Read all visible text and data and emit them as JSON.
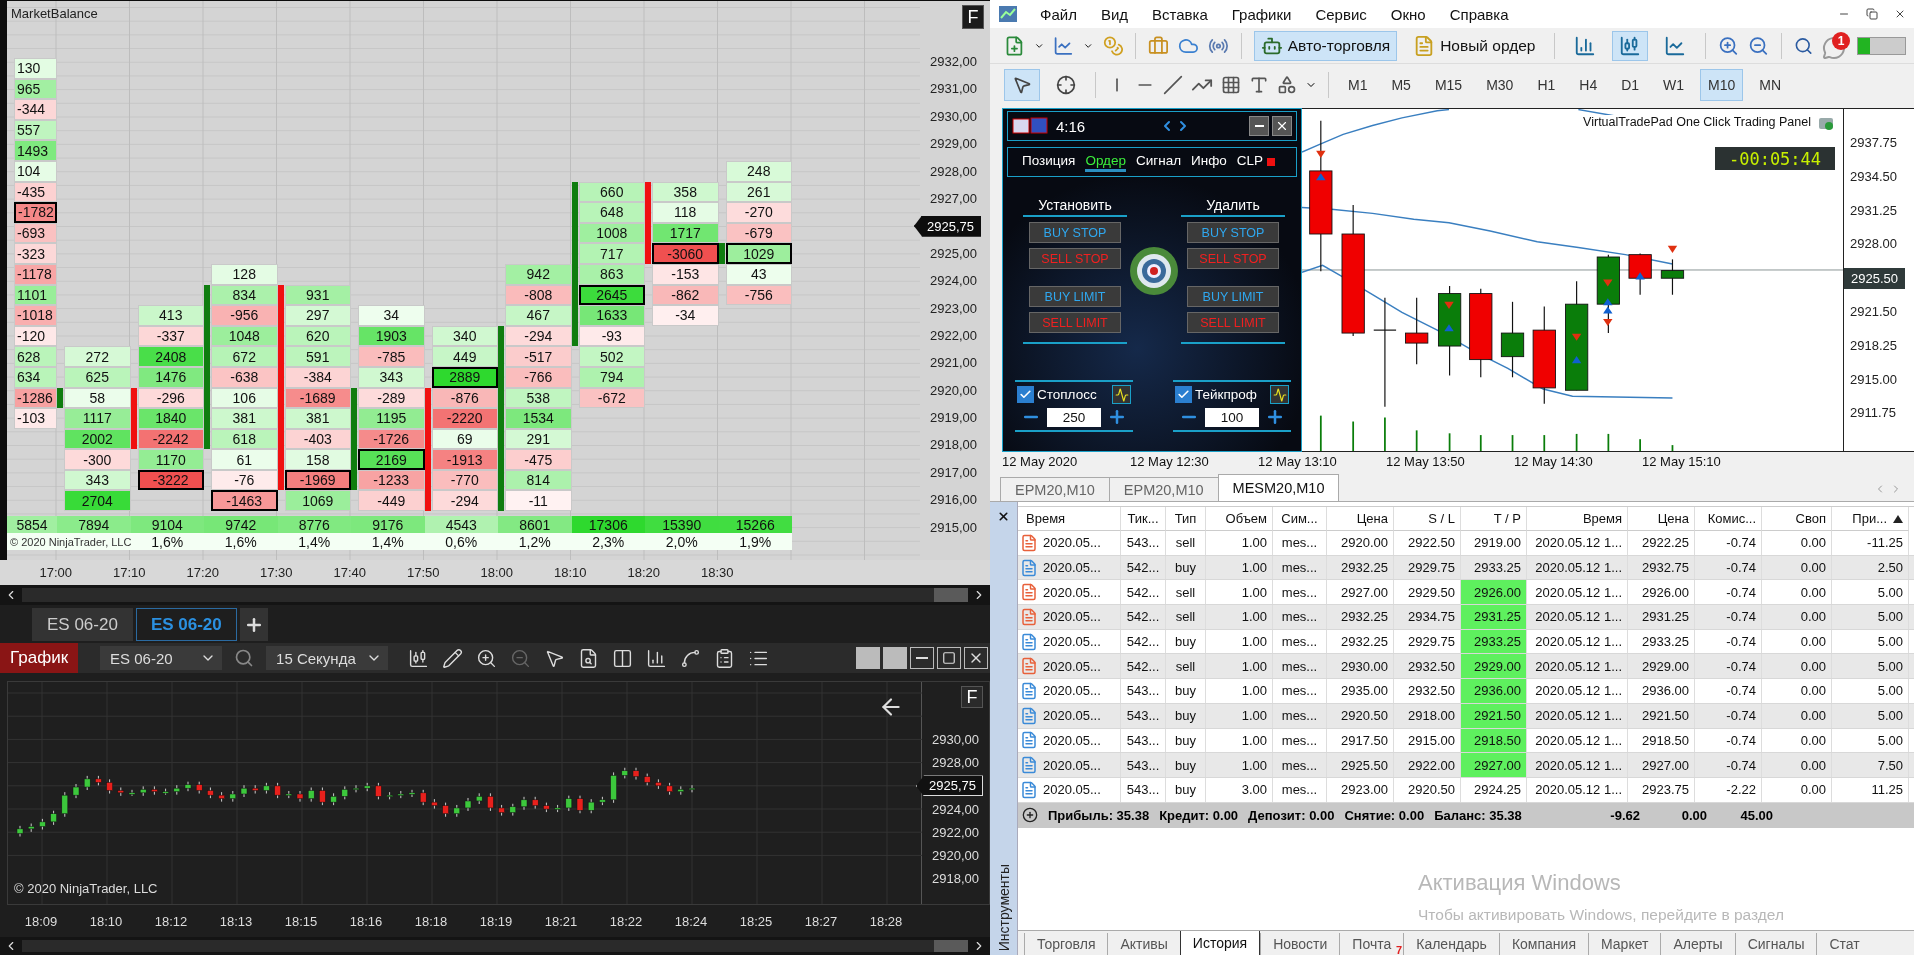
{
  "market_balance": {
    "title": "MarketBalance",
    "format_button": "F",
    "columns": [
      {
        "cells": [
          {
            "text": "130",
            "boxed": false,
            "bar": false
          },
          {
            "text": "965",
            "boxed": false,
            "bar": false
          },
          {
            "text": "-344",
            "boxed": false,
            "bar": false
          },
          {
            "text": "557",
            "boxed": false,
            "bar": false
          },
          {
            "text": "1493",
            "boxed": false,
            "bar": false
          },
          {
            "text": "104",
            "boxed": false,
            "bar": false
          },
          {
            "text": "-435",
            "boxed": false,
            "bar": false
          },
          {
            "text": "-1782",
            "boxed": true,
            "bar": false
          },
          {
            "text": "-693",
            "boxed": false,
            "bar": false
          },
          {
            "text": "-323",
            "boxed": false,
            "bar": false
          },
          {
            "text": "-1178",
            "boxed": false,
            "bar": false
          },
          {
            "text": "1101",
            "boxed": false,
            "bar": false
          },
          {
            "text": "-1018",
            "boxed": false,
            "bar": false
          },
          {
            "text": "-120",
            "boxed": false,
            "bar": false
          },
          {
            "text": "628",
            "boxed": false,
            "bar": false
          },
          {
            "text": "634",
            "boxed": false,
            "bar": false
          },
          {
            "text": "-1286",
            "boxed": false,
            "bar": false
          },
          {
            "text": "-103",
            "boxed": false,
            "bar": false
          }
        ]
      },
      {
        "rising": true,
        "cells": [
          null,
          null,
          null,
          null,
          null,
          null,
          null,
          null,
          null,
          null,
          null,
          null,
          null,
          null,
          {
            "text": "272",
            "boxed": false,
            "bar": false
          },
          {
            "text": "625",
            "boxed": false,
            "bar": false
          },
          {
            "text": "58",
            "boxed": false,
            "bar": true
          },
          {
            "text": "1117",
            "boxed": false,
            "bar": false
          },
          {
            "text": "2002",
            "boxed": false,
            "bar": false
          },
          {
            "text": "-300",
            "boxed": false,
            "bar": false
          },
          {
            "text": "343",
            "boxed": false,
            "bar": false
          },
          {
            "text": "2704",
            "boxed": false,
            "bar": false
          }
        ]
      },
      {
        "rising": false,
        "cells": [
          null,
          null,
          null,
          null,
          null,
          null,
          null,
          null,
          null,
          null,
          null,
          null,
          {
            "text": "413",
            "boxed": false,
            "bar": false
          },
          {
            "text": "-337",
            "boxed": false,
            "bar": false
          },
          {
            "text": "2408",
            "boxed": false,
            "bar": false
          },
          {
            "text": "1476",
            "boxed": false,
            "bar": false
          },
          {
            "text": "-296",
            "boxed": false,
            "bar": true
          },
          {
            "text": "1840",
            "boxed": false,
            "bar": true
          },
          {
            "text": "-2242",
            "boxed": false,
            "bar": true
          },
          {
            "text": "1170",
            "boxed": false,
            "bar": false
          },
          {
            "text": "-3222",
            "boxed": true,
            "bar": false
          }
        ]
      },
      {
        "rising": true,
        "cells": [
          null,
          null,
          null,
          null,
          null,
          null,
          null,
          null,
          null,
          null,
          {
            "text": "128",
            "boxed": false,
            "bar": false
          },
          {
            "text": "834",
            "boxed": false,
            "bar": true
          },
          {
            "text": "-956",
            "boxed": false,
            "bar": true
          },
          {
            "text": "1048",
            "boxed": false,
            "bar": true
          },
          {
            "text": "672",
            "boxed": false,
            "bar": true
          },
          {
            "text": "-638",
            "boxed": false,
            "bar": true
          },
          {
            "text": "106",
            "boxed": false,
            "bar": true
          },
          {
            "text": "381",
            "boxed": false,
            "bar": true
          },
          {
            "text": "618",
            "boxed": false,
            "bar": true
          },
          {
            "text": "61",
            "boxed": false,
            "bar": false
          },
          {
            "text": "-76",
            "boxed": false,
            "bar": false
          },
          {
            "text": "-1463",
            "boxed": true,
            "bar": false
          }
        ]
      },
      {
        "rising": false,
        "cells": [
          null,
          null,
          null,
          null,
          null,
          null,
          null,
          null,
          null,
          null,
          null,
          {
            "text": "931",
            "boxed": false,
            "bar": true
          },
          {
            "text": "297",
            "boxed": false,
            "bar": true
          },
          {
            "text": "620",
            "boxed": false,
            "bar": true
          },
          {
            "text": "591",
            "boxed": false,
            "bar": true
          },
          {
            "text": "-384",
            "boxed": false,
            "bar": true
          },
          {
            "text": "-1689",
            "boxed": false,
            "bar": true
          },
          {
            "text": "381",
            "boxed": false,
            "bar": true
          },
          {
            "text": "-403",
            "boxed": false,
            "bar": true
          },
          {
            "text": "158",
            "boxed": false,
            "bar": true
          },
          {
            "text": "-1969",
            "boxed": true,
            "bar": true
          },
          {
            "text": "1069",
            "boxed": false,
            "bar": false
          }
        ]
      },
      {
        "rising": true,
        "cells": [
          null,
          null,
          null,
          null,
          null,
          null,
          null,
          null,
          null,
          null,
          null,
          null,
          {
            "text": "34",
            "boxed": false,
            "bar": false
          },
          {
            "text": "1903",
            "boxed": false,
            "bar": false
          },
          {
            "text": "-785",
            "boxed": false,
            "bar": false
          },
          {
            "text": "343",
            "boxed": false,
            "bar": false
          },
          {
            "text": "-289",
            "boxed": false,
            "bar": true
          },
          {
            "text": "1195",
            "boxed": false,
            "bar": true
          },
          {
            "text": "-1726",
            "boxed": false,
            "bar": true
          },
          {
            "text": "2169",
            "boxed": true,
            "bar": true
          },
          {
            "text": "-1233",
            "boxed": false,
            "bar": true
          },
          {
            "text": "-449",
            "boxed": false,
            "bar": false
          }
        ]
      },
      {
        "rising": false,
        "cells": [
          null,
          null,
          null,
          null,
          null,
          null,
          null,
          null,
          null,
          null,
          null,
          null,
          null,
          {
            "text": "340",
            "boxed": false,
            "bar": false
          },
          {
            "text": "449",
            "boxed": false,
            "bar": false
          },
          {
            "text": "2889",
            "boxed": true,
            "bar": false
          },
          {
            "text": "-876",
            "boxed": false,
            "bar": true
          },
          {
            "text": "-2220",
            "boxed": false,
            "bar": true
          },
          {
            "text": "69",
            "boxed": false,
            "bar": true
          },
          {
            "text": "-1913",
            "boxed": false,
            "bar": true
          },
          {
            "text": "-770",
            "boxed": false,
            "bar": true
          },
          {
            "text": "-294",
            "boxed": false,
            "bar": true
          }
        ]
      },
      {
        "rising": true,
        "cells": [
          null,
          null,
          null,
          null,
          null,
          null,
          null,
          null,
          null,
          null,
          {
            "text": "942",
            "boxed": false,
            "bar": false
          },
          {
            "text": "-808",
            "boxed": false,
            "bar": false
          },
          {
            "text": "467",
            "boxed": false,
            "bar": false
          },
          {
            "text": "-294",
            "boxed": false,
            "bar": true
          },
          {
            "text": "-517",
            "boxed": false,
            "bar": true
          },
          {
            "text": "-766",
            "boxed": false,
            "bar": true
          },
          {
            "text": "538",
            "boxed": false,
            "bar": true
          },
          {
            "text": "1534",
            "boxed": false,
            "bar": true
          },
          {
            "text": "291",
            "boxed": false,
            "bar": true
          },
          {
            "text": "-475",
            "boxed": false,
            "bar": true
          },
          {
            "text": "814",
            "boxed": false,
            "bar": true
          },
          {
            "text": "-11",
            "boxed": false,
            "bar": true
          }
        ]
      },
      {
        "rising": true,
        "cells": [
          null,
          null,
          null,
          null,
          null,
          null,
          {
            "text": "660",
            "boxed": false,
            "bar": true
          },
          {
            "text": "648",
            "boxed": false,
            "bar": true
          },
          {
            "text": "1008",
            "boxed": false,
            "bar": true
          },
          {
            "text": "717",
            "boxed": false,
            "bar": true
          },
          {
            "text": "863",
            "boxed": false,
            "bar": true
          },
          {
            "text": "2645",
            "boxed": true,
            "bar": true
          },
          {
            "text": "1633",
            "boxed": false,
            "bar": true
          },
          {
            "text": "-93",
            "boxed": false,
            "bar": true
          },
          {
            "text": "502",
            "boxed": false,
            "bar": false
          },
          {
            "text": "794",
            "boxed": false,
            "bar": false
          },
          {
            "text": "-672",
            "boxed": false,
            "bar": false
          }
        ]
      },
      {
        "rising": false,
        "cells": [
          null,
          null,
          null,
          null,
          null,
          null,
          {
            "text": "358",
            "boxed": false,
            "bar": true
          },
          {
            "text": "118",
            "boxed": false,
            "bar": true
          },
          {
            "text": "1717",
            "boxed": false,
            "bar": true
          },
          {
            "text": "-3060",
            "boxed": true,
            "bar": true
          },
          {
            "text": "-153",
            "boxed": false,
            "bar": false
          },
          {
            "text": "-862",
            "boxed": false,
            "bar": false
          },
          {
            "text": "-34",
            "boxed": false,
            "bar": false
          }
        ]
      },
      {
        "rising": true,
        "cells": [
          null,
          null,
          null,
          null,
          null,
          {
            "text": "248",
            "boxed": false,
            "bar": false
          },
          {
            "text": "261",
            "boxed": false,
            "bar": false
          },
          {
            "text": "-270",
            "boxed": false,
            "bar": false
          },
          {
            "text": "-679",
            "boxed": false,
            "bar": false
          },
          {
            "text": "1029",
            "boxed": true,
            "bar": true
          },
          {
            "text": "43",
            "boxed": false,
            "bar": false
          },
          {
            "text": "-756",
            "boxed": false,
            "bar": false
          }
        ]
      }
    ],
    "totals": [
      "5854",
      "7894",
      "9104",
      "9742",
      "8776",
      "9176",
      "4543",
      "8601",
      "17306",
      "15390",
      "15266"
    ],
    "percents": [
      "1,6%",
      "1,6%",
      "1,4%",
      "1,4%",
      "0,6%",
      "1,2%",
      "2,3%",
      "2,0%",
      "1,9%"
    ],
    "price_axis_upper": [
      "2932,00",
      "2931,00",
      "2930,00",
      "2929,00",
      "2928,00",
      "2927,00"
    ],
    "price_axis_lower": [
      "2925,00",
      "2924,00",
      "2923,00",
      "2922,00",
      "2921,00",
      "2920,00",
      "2919,00",
      "2918,00",
      "2917,00",
      "2916,00",
      "2915,00"
    ],
    "price_tag": "2925,75",
    "copyright": "© 2020 NinjaTrader, LLC",
    "time_axis": [
      "17:00",
      "17:10",
      "17:20",
      "17:30",
      "17:40",
      "17:50",
      "18:00",
      "18:10",
      "18:20",
      "18:30"
    ]
  },
  "instrument_tabs": [
    {
      "label": "ES 06-20",
      "selected": false
    },
    {
      "label": "ES 06-20",
      "selected": true
    }
  ],
  "chart_toolbar": {
    "title": "График",
    "instrument": "ES 06-20",
    "interval": "15 Секунда"
  },
  "mini_chart": {
    "format_button": "F",
    "price_axis_upper": [
      "2930,00",
      "2928,00"
    ],
    "price_axis_lower": [
      "2924,00",
      "2922,00",
      "2920,00",
      "2918,00"
    ],
    "price_tag": "2925,75",
    "copyright": "© 2020 NinjaTrader, LLC",
    "time_axis": [
      "18:09",
      "18:10",
      "18:12",
      "18:13",
      "18:15",
      "18:16",
      "18:18",
      "18:19",
      "18:21",
      "18:22",
      "18:24",
      "18:25",
      "18:27",
      "18:28"
    ]
  },
  "menu": [
    "Файл",
    "Вид",
    "Вставка",
    "Графики",
    "Сервис",
    "Окно",
    "Справка"
  ],
  "toolbar": {
    "auto_trading": {
      "label": "Авто-торговля",
      "selected": true
    },
    "new_order": "Новый ордер",
    "chart_types": [
      {
        "kind": "bars",
        "selected": false
      },
      {
        "kind": "candles",
        "selected": true
      },
      {
        "kind": "line",
        "selected": false
      }
    ],
    "notifications": "1"
  },
  "tools": [
    {
      "kind": "cursor",
      "selected": true
    },
    {
      "kind": "crosshair",
      "selected": false
    }
  ],
  "timeframes": [
    {
      "label": "M1",
      "selected": false
    },
    {
      "label": "M5",
      "selected": false
    },
    {
      "label": "M15",
      "selected": false
    },
    {
      "label": "M30",
      "selected": false
    },
    {
      "label": "H1",
      "selected": false
    },
    {
      "label": "H4",
      "selected": false
    },
    {
      "label": "D1",
      "selected": false
    },
    {
      "label": "W1",
      "selected": false
    },
    {
      "label": "M10",
      "selected": true
    },
    {
      "label": "MN",
      "selected": false
    }
  ],
  "trade_panel": {
    "clock": "4:16",
    "tabs": [
      {
        "label": "Позиция",
        "selected": false
      },
      {
        "label": "Ордер",
        "selected": true
      },
      {
        "label": "Сигнал",
        "selected": false
      },
      {
        "label": "Инфо",
        "selected": false
      },
      {
        "label": "CLP",
        "selected": false
      }
    ],
    "groups": [
      {
        "heading": "Установить",
        "buttons": [
          {
            "label": "BUY STOP",
            "kind": "buy"
          },
          {
            "label": "SELL STOP",
            "kind": "sell"
          },
          {
            "label": "BUY LIMIT",
            "kind": "buy"
          },
          {
            "label": "SELL LIMIT",
            "kind": "sell"
          }
        ]
      },
      {
        "heading": "Удалить",
        "buttons": [
          {
            "label": "BUY STOP",
            "kind": "buy"
          },
          {
            "label": "SELL STOP",
            "kind": "sell"
          },
          {
            "label": "BUY LIMIT",
            "kind": "buy"
          },
          {
            "label": "SELL LIMIT",
            "kind": "sell"
          }
        ]
      }
    ],
    "stops": [
      {
        "label": "Стоплосс",
        "checked": true,
        "value": "250"
      },
      {
        "label": "Тейкпроф",
        "checked": true,
        "value": "100"
      }
    ]
  },
  "price_chart": {
    "caption": "VirtualTradePad One Click Trading Panel",
    "timer": "-00:05:44",
    "price_axis_upper": [
      "2937.75",
      "2934.50",
      "2931.25",
      "2928.00"
    ],
    "price_axis_lower": [
      "2921.50",
      "2918.25",
      "2915.00",
      "2911.75"
    ],
    "price_tag": "2925.50",
    "time_axis": [
      "12 May 2020",
      "12 May 12:30",
      "12 May 13:10",
      "12 May 13:50",
      "12 May 14:30",
      "12 May 15:10"
    ]
  },
  "chart_tabs": [
    {
      "label": "EPM20,M10",
      "selected": false
    },
    {
      "label": "EPM20,M10",
      "selected": false
    },
    {
      "label": "MESM20,M10",
      "selected": true
    }
  ],
  "side_label": "Инструменты",
  "history": {
    "columns": [
      {
        "label": "Время",
        "sorted": false
      },
      {
        "label": "Тик...",
        "sorted": false
      },
      {
        "label": "Тип",
        "sorted": false
      },
      {
        "label": "Объем",
        "sorted": false
      },
      {
        "label": "Сим...",
        "sorted": false
      },
      {
        "label": "Цена",
        "sorted": false
      },
      {
        "label": "S / L",
        "sorted": false
      },
      {
        "label": "T / P",
        "sorted": false
      },
      {
        "label": "Время",
        "sorted": false
      },
      {
        "label": "Цена",
        "sorted": false
      },
      {
        "label": "Комис...",
        "sorted": false
      },
      {
        "label": "Своп",
        "sorted": false
      },
      {
        "label": "При...",
        "sorted": true
      }
    ],
    "rows": [
      {
        "kind": "sell",
        "time": "2020.05...",
        "ticket": "543...",
        "type": "sell",
        "volume": "1.00",
        "symbol": "mes...",
        "price": "2920.00",
        "sl": "2922.50",
        "tp": "2919.00",
        "tp_hit": false,
        "close_time": "2020.05.12 1...",
        "close_price": "2922.25",
        "commission": "-0.74",
        "swap": "0.00",
        "profit": "-11.25"
      },
      {
        "kind": "buy",
        "time": "2020.05...",
        "ticket": "542...",
        "type": "buy",
        "volume": "1.00",
        "symbol": "mes...",
        "price": "2932.25",
        "sl": "2929.75",
        "tp": "2933.25",
        "tp_hit": false,
        "close_time": "2020.05.12 1...",
        "close_price": "2932.75",
        "commission": "-0.74",
        "swap": "0.00",
        "profit": "2.50"
      },
      {
        "kind": "sell",
        "time": "2020.05...",
        "ticket": "542...",
        "type": "sell",
        "volume": "1.00",
        "symbol": "mes...",
        "price": "2927.00",
        "sl": "2929.50",
        "tp": "2926.00",
        "tp_hit": true,
        "close_time": "2020.05.12 1...",
        "close_price": "2926.00",
        "commission": "-0.74",
        "swap": "0.00",
        "profit": "5.00"
      },
      {
        "kind": "sell",
        "time": "2020.05...",
        "ticket": "542...",
        "type": "sell",
        "volume": "1.00",
        "symbol": "mes...",
        "price": "2932.25",
        "sl": "2934.75",
        "tp": "2931.25",
        "tp_hit": true,
        "close_time": "2020.05.12 1...",
        "close_price": "2931.25",
        "commission": "-0.74",
        "swap": "0.00",
        "profit": "5.00"
      },
      {
        "kind": "buy",
        "time": "2020.05...",
        "ticket": "542...",
        "type": "buy",
        "volume": "1.00",
        "symbol": "mes...",
        "price": "2932.25",
        "sl": "2929.75",
        "tp": "2933.25",
        "tp_hit": true,
        "close_time": "2020.05.12 1...",
        "close_price": "2933.25",
        "commission": "-0.74",
        "swap": "0.00",
        "profit": "5.00"
      },
      {
        "kind": "sell",
        "time": "2020.05...",
        "ticket": "542...",
        "type": "sell",
        "volume": "1.00",
        "symbol": "mes...",
        "price": "2930.00",
        "sl": "2932.50",
        "tp": "2929.00",
        "tp_hit": true,
        "close_time": "2020.05.12 1...",
        "close_price": "2929.00",
        "commission": "-0.74",
        "swap": "0.00",
        "profit": "5.00"
      },
      {
        "kind": "buy",
        "time": "2020.05...",
        "ticket": "543...",
        "type": "buy",
        "volume": "1.00",
        "symbol": "mes...",
        "price": "2935.00",
        "sl": "2932.50",
        "tp": "2936.00",
        "tp_hit": true,
        "close_time": "2020.05.12 1...",
        "close_price": "2936.00",
        "commission": "-0.74",
        "swap": "0.00",
        "profit": "5.00"
      },
      {
        "kind": "buy",
        "time": "2020.05...",
        "ticket": "543...",
        "type": "buy",
        "volume": "1.00",
        "symbol": "mes...",
        "price": "2920.50",
        "sl": "2918.00",
        "tp": "2921.50",
        "tp_hit": true,
        "close_time": "2020.05.12 1...",
        "close_price": "2921.50",
        "commission": "-0.74",
        "swap": "0.00",
        "profit": "5.00"
      },
      {
        "kind": "buy",
        "time": "2020.05...",
        "ticket": "543...",
        "type": "buy",
        "volume": "1.00",
        "symbol": "mes...",
        "price": "2917.50",
        "sl": "2915.00",
        "tp": "2918.50",
        "tp_hit": true,
        "close_time": "2020.05.12 1...",
        "close_price": "2918.50",
        "commission": "-0.74",
        "swap": "0.00",
        "profit": "5.00"
      },
      {
        "kind": "buy",
        "time": "2020.05...",
        "ticket": "543...",
        "type": "buy",
        "volume": "1.00",
        "symbol": "mes...",
        "price": "2925.50",
        "sl": "2922.00",
        "tp": "2927.00",
        "tp_hit": true,
        "close_time": "2020.05.12 1...",
        "close_price": "2927.00",
        "commission": "-0.74",
        "swap": "0.00",
        "profit": "7.50"
      },
      {
        "kind": "buy",
        "time": "2020.05...",
        "ticket": "543...",
        "type": "buy",
        "volume": "3.00",
        "symbol": "mes...",
        "price": "2923.00",
        "sl": "2920.50",
        "tp": "2924.25",
        "tp_hit": false,
        "close_time": "2020.05.12 1...",
        "close_price": "2923.75",
        "commission": "-2.22",
        "swap": "0.00",
        "profit": "11.25"
      }
    ],
    "summary": {
      "parts": [
        "Прибыль: 35.38",
        "Кредит: 0.00",
        "Депозит: 0.00",
        "Снятие: 0.00",
        "Баланс: 35.38"
      ],
      "commission": "-9.62",
      "swap": "0.00",
      "profit": "45.00"
    }
  },
  "windows_activation": {
    "title": "Активация Windows",
    "text": "Чтобы активировать Windows, перейдите в раздел"
  },
  "terminal_tabs": [
    {
      "label": "Торговля",
      "selected": false
    },
    {
      "label": "Активы",
      "selected": false
    },
    {
      "label": "История",
      "selected": true
    },
    {
      "label": "Новости",
      "selected": false
    },
    {
      "label": "Почта",
      "selected": false,
      "badge": "7"
    },
    {
      "label": "Календарь",
      "selected": false
    },
    {
      "label": "Компания",
      "selected": false
    },
    {
      "label": "Маркет",
      "selected": false
    },
    {
      "label": "Алерты",
      "selected": false
    },
    {
      "label": "Сигналы",
      "selected": false
    },
    {
      "label": "Стат",
      "selected": false
    }
  ]
}
